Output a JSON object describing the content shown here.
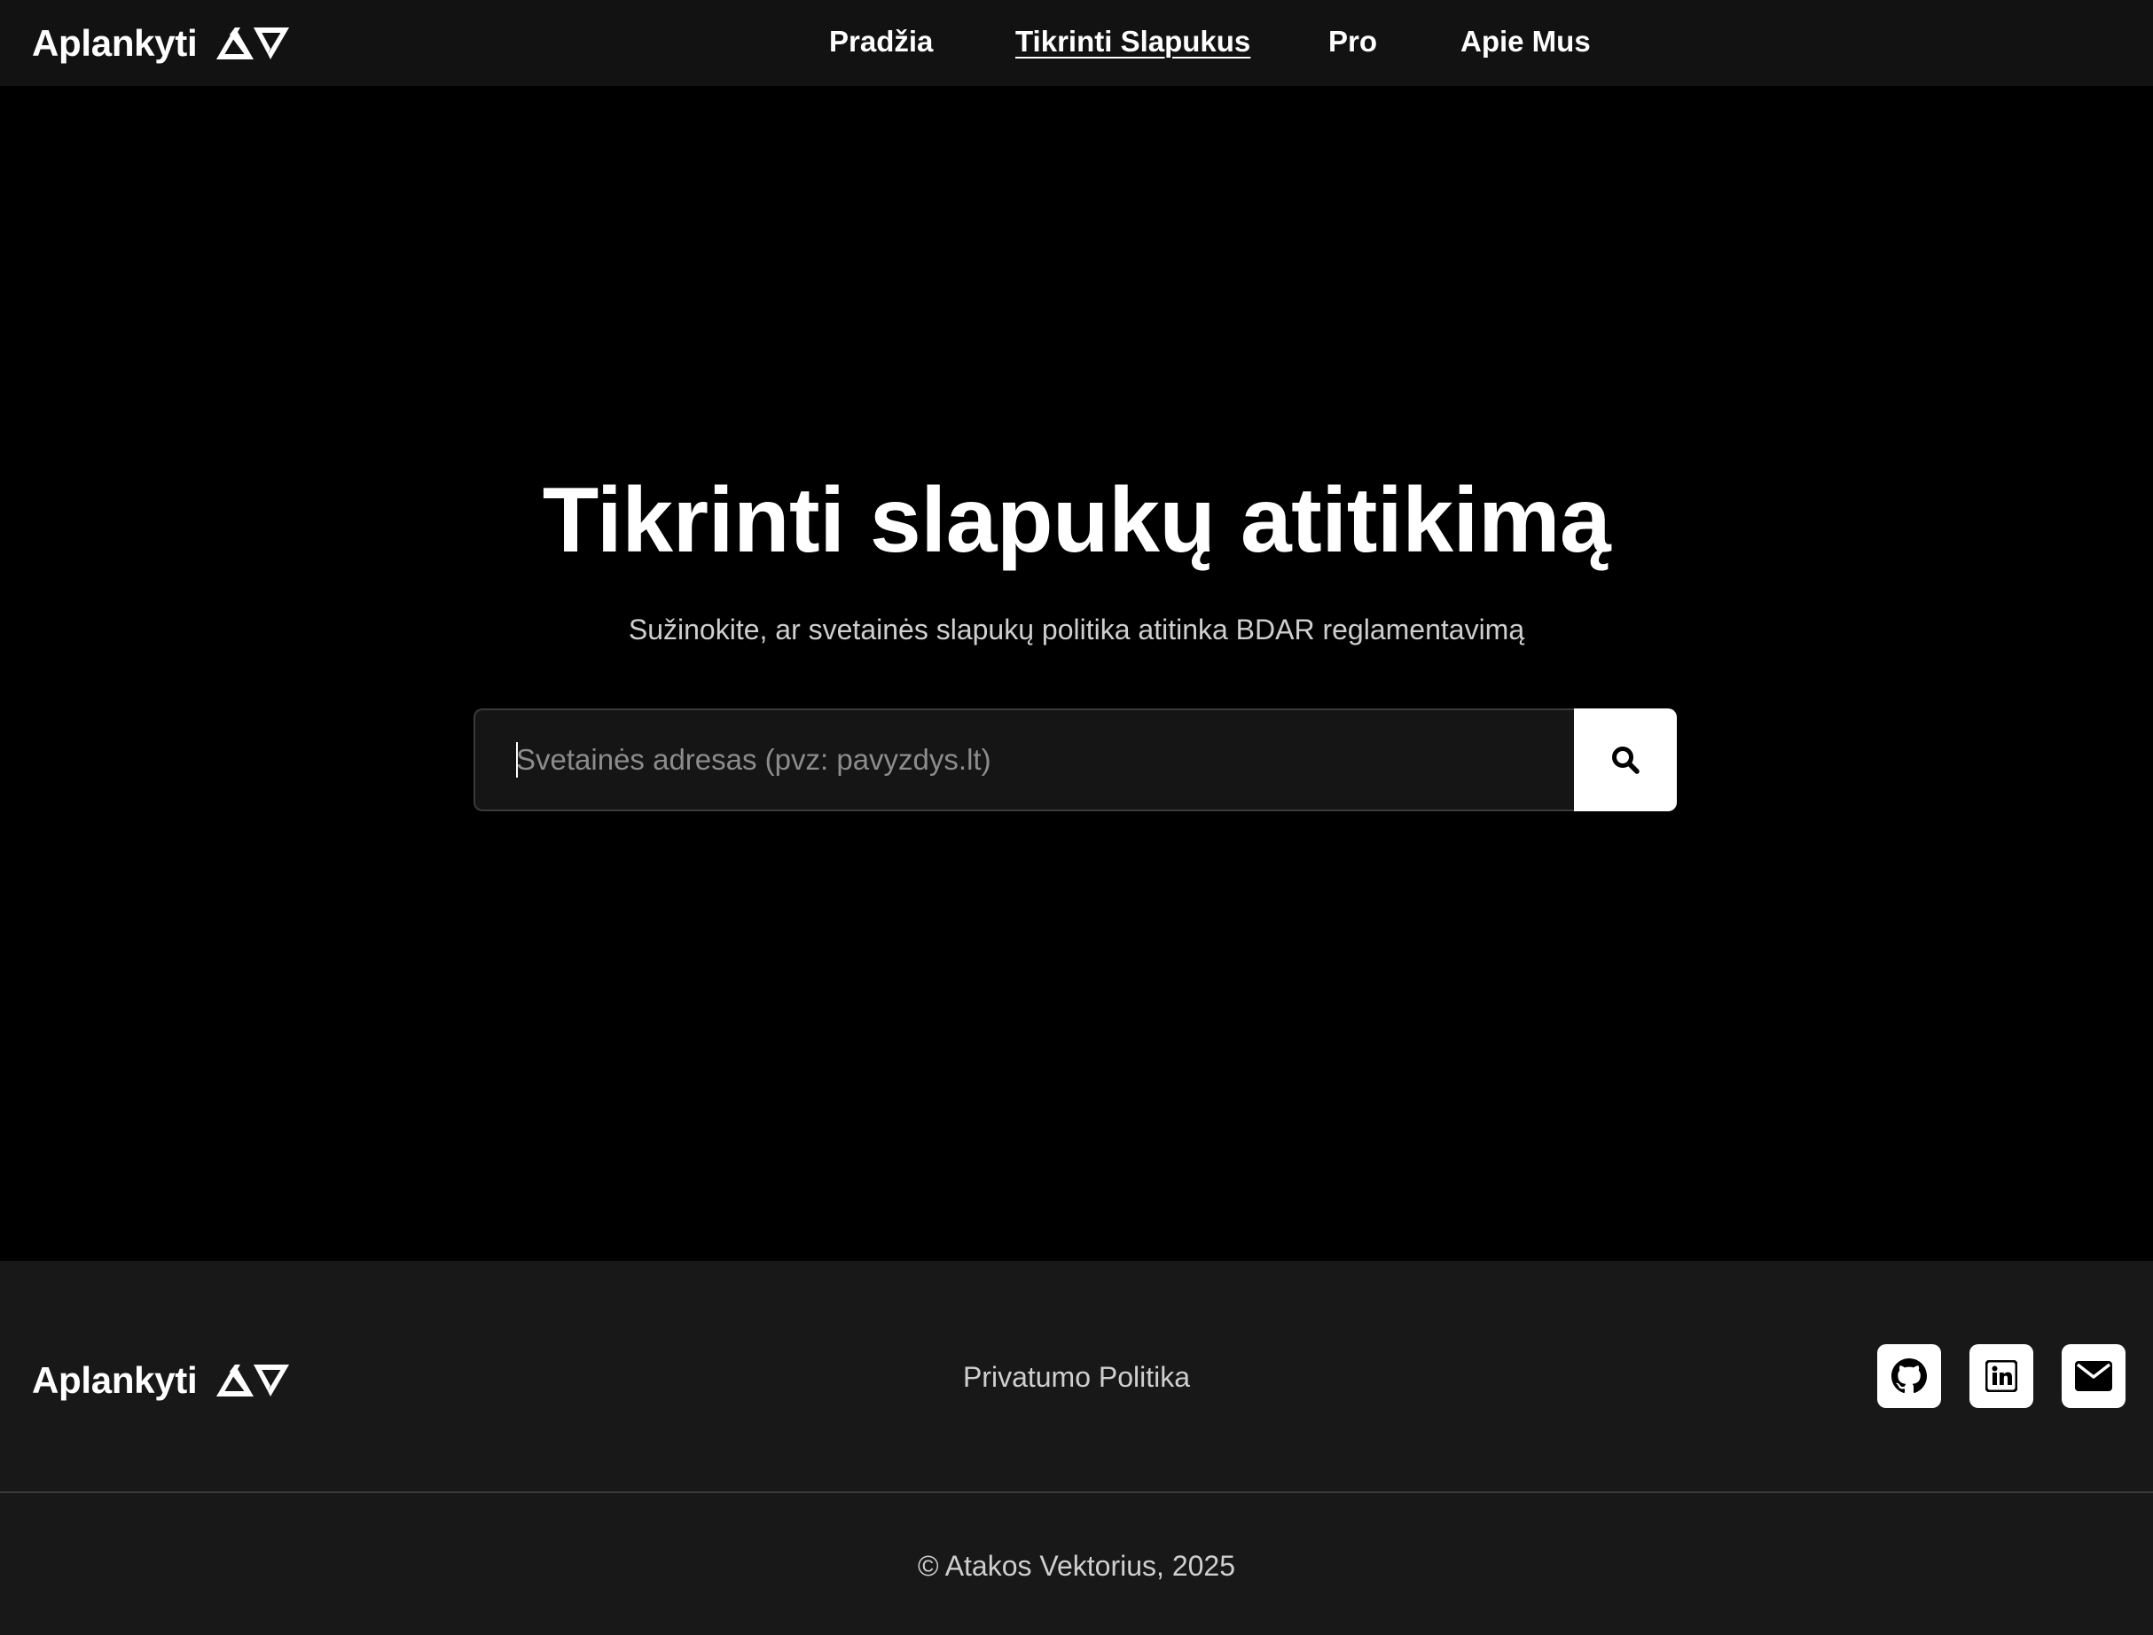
{
  "header": {
    "brand": "Aplankyti",
    "nav": [
      {
        "label": "Pradžia",
        "active": false
      },
      {
        "label": "Tikrinti Slapukus",
        "active": true
      },
      {
        "label": "Pro",
        "active": false
      },
      {
        "label": "Apie Mus",
        "active": false
      }
    ]
  },
  "hero": {
    "title": "Tikrinti slapukų atitikimą",
    "subtitle": "Sužinokite, ar svetainės slapukų politika atitinka BDAR reglamentavimą",
    "search": {
      "placeholder": "Svetainės adresas (pvz: pavyzdys.lt)",
      "value": "",
      "button_icon": "search-icon"
    }
  },
  "footer": {
    "brand": "Aplankyti",
    "privacy_link": "Privatumo Politika",
    "social": [
      {
        "icon": "github-icon"
      },
      {
        "icon": "linkedin-icon"
      },
      {
        "icon": "email-icon"
      }
    ],
    "copyright": "© Atakos Vektorius, 2025"
  },
  "colors": {
    "background": "#000000",
    "header_bg": "#121212",
    "footer_bg": "#181818",
    "text_primary": "#ffffff",
    "text_muted": "#cfcfcf",
    "input_bg": "#151515",
    "placeholder": "#8c8c8c",
    "button_bg": "#ffffff"
  }
}
